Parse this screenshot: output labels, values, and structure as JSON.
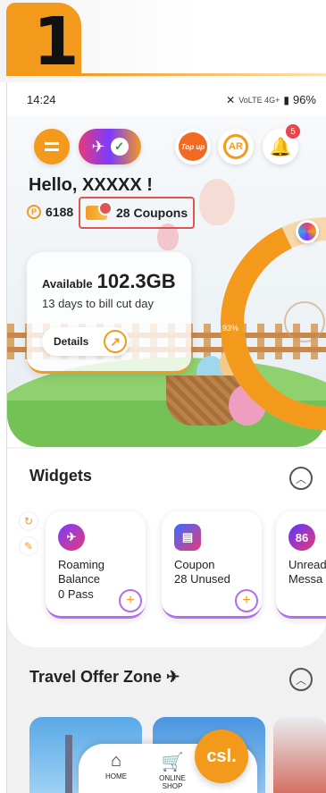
{
  "step": {
    "number": "1"
  },
  "status_bar": {
    "time": "14:24",
    "net_icons": "VoLTE 4G+",
    "battery": "96%"
  },
  "header": {
    "roaming_badge_icon": "airplane-icon",
    "topup_label": "Top up",
    "ar_label": "AR",
    "notification_count": "5",
    "greeting": "Hello, XXXXX !",
    "points": "6188",
    "coupons": "28 Coupons"
  },
  "data_card": {
    "available_label": "Available",
    "available_value": "102.3GB",
    "bill_cut": "13 days to bill cut day",
    "details_label": "Details"
  },
  "usage_ring": {
    "percent_label": "93%",
    "percent": 93,
    "color": "#f39a1d"
  },
  "widgets": {
    "title": "Widgets",
    "items": [
      {
        "line1": "Roaming",
        "line2": "Balance",
        "line3": "0 Pass"
      },
      {
        "line1": "Coupon",
        "line2": "28 Unused",
        "line3": ""
      },
      {
        "line1": "Unread",
        "line2": "Messa",
        "line3": ""
      }
    ],
    "item3_icon_text": "86"
  },
  "travel": {
    "title": "Travel Offer Zone"
  },
  "bottom_nav": {
    "home_label": "HOME",
    "shop_label": "ONLINE SHOP",
    "csl_label": "csl."
  },
  "colors": {
    "accent": "#f39a1d",
    "alert": "#e05454",
    "purple": "#b26df0"
  }
}
